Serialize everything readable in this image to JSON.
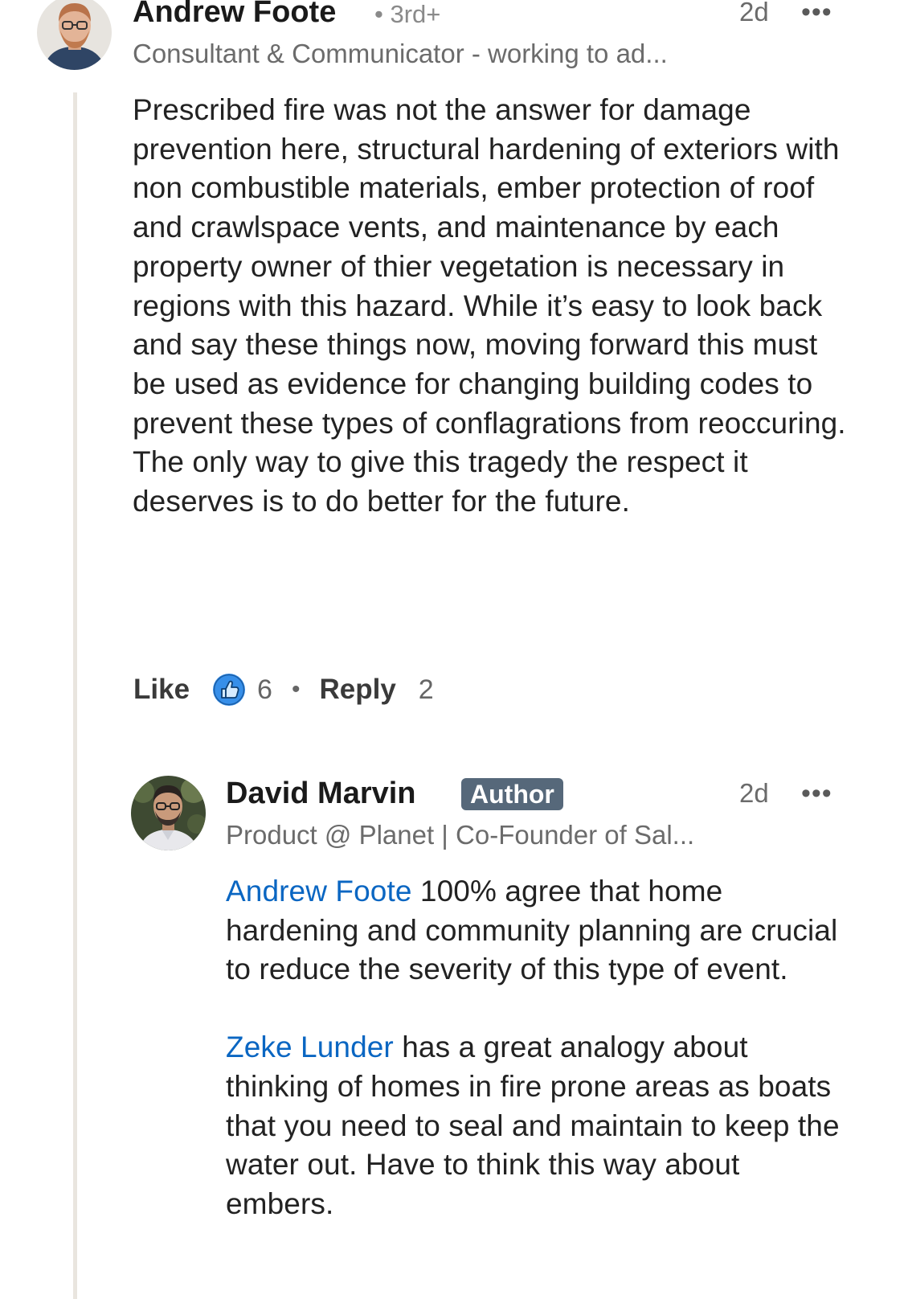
{
  "comment": {
    "author": "Andrew Foote",
    "degree": "• 3rd+",
    "time": "2d",
    "more": "•••",
    "headline": "Consultant & Communicator - working to ad...",
    "text": "Prescribed fire was not the answer for damage prevention here, structural hardening of exteriors with non combustible materials, ember protection of roof and crawlspace vents, and maintenance by each property owner of thier vegetation is necessary in regions with this hazard. While it’s easy to look back and say these things now, moving forward this must be used as evidence for changing building codes to prevent these types of conflagrations from reoccuring. The only way to give this tragedy the respect it deserves is to do better for the future.",
    "like_label": "Like",
    "reaction_count": "6",
    "separator": "•",
    "reply_label": "Reply",
    "reply_count": "2"
  },
  "reply": {
    "author": "David Marvin",
    "badge": "Author",
    "time": "2d",
    "more": "•••",
    "headline": "Product @ Planet | Co-Founder of Sal...",
    "paragraph1_mention": "Andrew Foote",
    "paragraph1_text": " 100% agree that home hardening and community planning are crucial to reduce the severity of this type of event.",
    "paragraph2_mention": "Zeke Lunder",
    "paragraph2_text": " has a great analogy about thinking of homes in fire prone areas as boats that you need to seal and maintain to keep the water out. Have to think this way about embers."
  },
  "colors": {
    "link": "#0a66c2",
    "badge_bg": "#56687a",
    "like_icon": "#378fe9",
    "thread_line": "#e9e5df"
  },
  "icons": {
    "reaction": "like-thumbs-up-icon",
    "more": "more-horizontal-icon"
  }
}
